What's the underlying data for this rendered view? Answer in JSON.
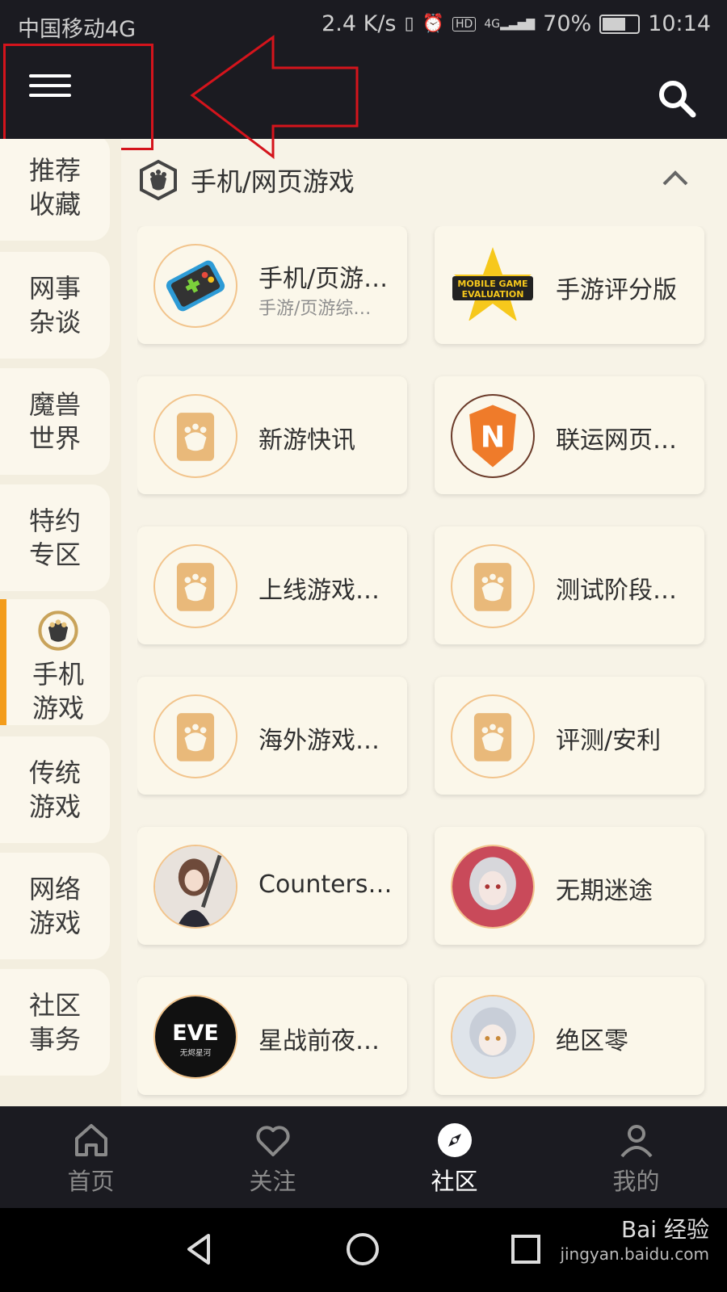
{
  "status_bar": {
    "carrier": "中国移动4G",
    "speed": "2.4 K/s",
    "battery": "70%",
    "time": "10:14",
    "signal_label": "4G",
    "hd_label": "HD"
  },
  "header": {
    "menu_icon": "menu-icon",
    "search_icon": "search-icon"
  },
  "sidebar": {
    "items": [
      {
        "label": "推荐收藏"
      },
      {
        "label": "网事杂谈"
      },
      {
        "label": "魔兽世界"
      },
      {
        "label": "特约专区"
      },
      {
        "label": "手机游戏",
        "active": true
      },
      {
        "label": "传统游戏"
      },
      {
        "label": "网络游戏"
      },
      {
        "label": "社区事务"
      }
    ]
  },
  "section": {
    "title": "手机/网页游戏",
    "collapse_icon": "chevron-up-icon"
  },
  "forums": [
    {
      "name": "手机/页游综合讨论",
      "sub": "手游/页游综合讨论"
    },
    {
      "name": "手游评分版",
      "sub": ""
    },
    {
      "name": "新游快讯",
      "sub": ""
    },
    {
      "name": "联运网页游戏",
      "sub": ""
    },
    {
      "name": "上线游戏讨论",
      "sub": ""
    },
    {
      "name": "测试阶段游戏",
      "sub": ""
    },
    {
      "name": "海外游戏讨论",
      "sub": ""
    },
    {
      "name": "评测/安利",
      "sub": ""
    },
    {
      "name": "Counterside",
      "sub": ""
    },
    {
      "name": "无期迷途",
      "sub": ""
    },
    {
      "name": "星战前夜：无烬星河",
      "sub": ""
    },
    {
      "name": "绝区零",
      "sub": ""
    }
  ],
  "logo_text": {
    "mobile_game_eval": "MOBILE GAME EVALUATION",
    "n_badge": "N",
    "eve": "EVE",
    "eve_sub": "无烬星河"
  },
  "bottom_nav": {
    "items": [
      {
        "label": "首页",
        "icon": "home-icon"
      },
      {
        "label": "关注",
        "icon": "heart-icon"
      },
      {
        "label": "社区",
        "icon": "compass-icon",
        "active": true
      },
      {
        "label": "我的",
        "icon": "user-icon"
      }
    ]
  },
  "watermark": {
    "brand": "Bai 经验",
    "url": "jingyan.baidu.com"
  },
  "colors": {
    "accent": "#f39c1b",
    "dark": "#1b1b21",
    "bg": "#f7f3e7",
    "annotation": "#d4141c"
  }
}
